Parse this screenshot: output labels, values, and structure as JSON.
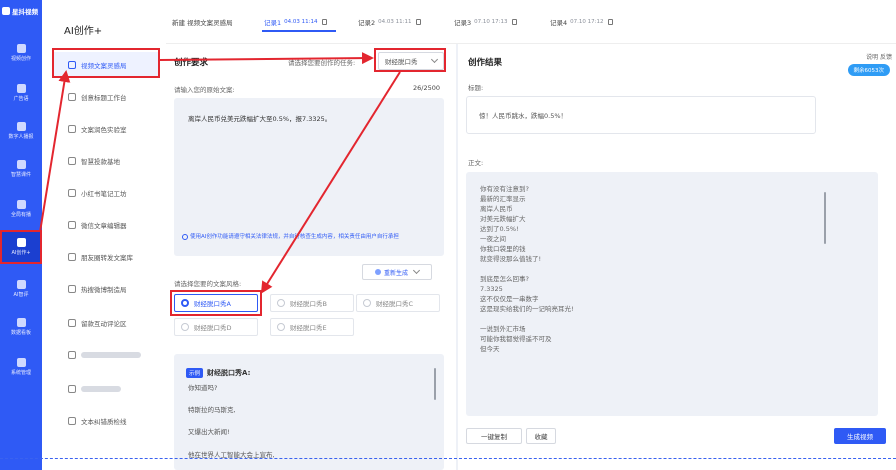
{
  "rail": {
    "logo": "星抖视频",
    "items": [
      "视频创作",
      "广告语",
      "数字人播报",
      "智慧课件",
      "全局有播",
      "AI创作+",
      "AI智评",
      "数据看板",
      "系统管理"
    ]
  },
  "sidebar": {
    "title": "AI创作+",
    "items": [
      {
        "label": "视频文案灵感局",
        "active": true
      },
      {
        "label": "创意标题工作台"
      },
      {
        "label": "文案润色实验室"
      },
      {
        "label": "智慧投款基地"
      },
      {
        "label": "小红书笔记工坊"
      },
      {
        "label": "微信文章编辑器"
      },
      {
        "label": "朋友圈转发文案库"
      },
      {
        "label": "热搜微博制造局"
      },
      {
        "label": "留款互动评论区"
      },
      {
        "label": ""
      },
      {
        "label": ""
      },
      {
        "label": "文本纠错质检线"
      }
    ]
  },
  "tabs": [
    {
      "label": "新建 视频文案灵感局",
      "time": ""
    },
    {
      "label": "记录1",
      "time": "04.03 11:14"
    },
    {
      "label": "记录2",
      "time": "04.03 11:11"
    },
    {
      "label": "记录3",
      "time": "07.10 17:13"
    },
    {
      "label": "记录4",
      "time": "07.10 17:12"
    }
  ],
  "left_panel": {
    "title": "创作要求",
    "task_prompt": "请选择您要创作的任务:",
    "task_value": "财经脱口秀",
    "input_label": "请输入您的原始文案:",
    "counter": "26/2500",
    "input_value": "离岸人民币兑美元跌幅扩大至0.5%，报7.3325。",
    "notice": "使用AI创作功能请遵守相关法律法规，并自行核查生成内容，相关责任由用户自行承担",
    "style_prompt": "请选择您要的文案风格:",
    "regen_label": "重新生成",
    "styles": [
      "财经脱口秀A",
      "财经脱口秀B",
      "财经脱口秀C",
      "财经脱口秀D",
      "财经脱口秀E"
    ],
    "example": {
      "badge": "示例",
      "title": "财经脱口秀A:",
      "lines": [
        "你知道吗?",
        "特斯拉的马斯克,",
        "又爆出大新闻!",
        "他在世界人工智能大会上宣布,"
      ]
    }
  },
  "right_panel": {
    "title": "创作结果",
    "links": "说明  反馈",
    "badge": "剩余6053次",
    "title_label": "标题:",
    "title_value": "惊！人民币跳水，跌幅0.5%！",
    "body_label": "正文:",
    "body_lines": [
      "你有没有注意到?",
      "最新的汇率显示",
      "离岸人民币",
      "对美元跌幅扩大",
      "达到了0.5%!",
      "一夜之间",
      "你我口袋里的钱",
      "就变得没那么值钱了!",
      "",
      "到底是怎么回事?",
      "7.3325",
      "这不仅仅是一串数字",
      "这是现实给我们的一记响亮耳光!",
      "",
      "一说到外汇市场",
      "可能你我都觉得遥不可及",
      "但今天"
    ],
    "copy_btn": "一键复制",
    "fav_btn": "收藏",
    "gen_btn": "生成视频"
  },
  "colors": {
    "accent": "#2f5af5",
    "annotation": "#e3262f"
  }
}
